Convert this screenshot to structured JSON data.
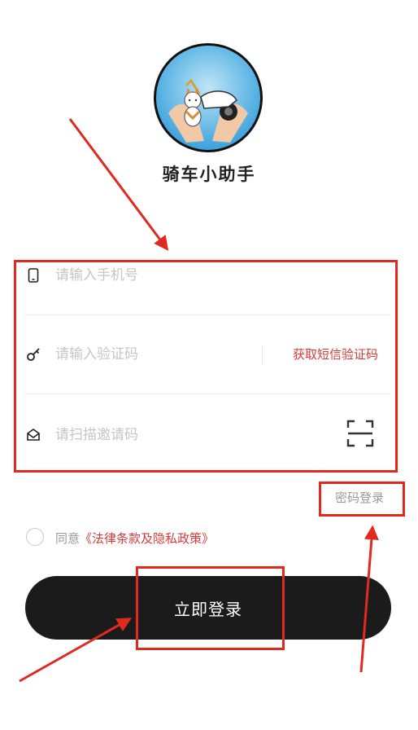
{
  "app": {
    "name": "骑车小助手"
  },
  "form": {
    "phone": {
      "placeholder": "请输入手机号",
      "icon": "phone-icon"
    },
    "code": {
      "placeholder": "请输入验证码",
      "icon": "key-icon",
      "get_code_label": "获取短信验证码"
    },
    "invite": {
      "placeholder": "请扫描邀请码",
      "icon": "envelope-icon",
      "scan_icon": "scan-icon"
    }
  },
  "password_login_label": "密码登录",
  "agreement": {
    "prefix": "同意",
    "link": "《法律条款及隐私政策》"
  },
  "login_button_label": "立即登录",
  "colors": {
    "accent_red": "#d63a3a",
    "annotation_red": "#e02a20",
    "button_bg": "#1b1b1b"
  }
}
